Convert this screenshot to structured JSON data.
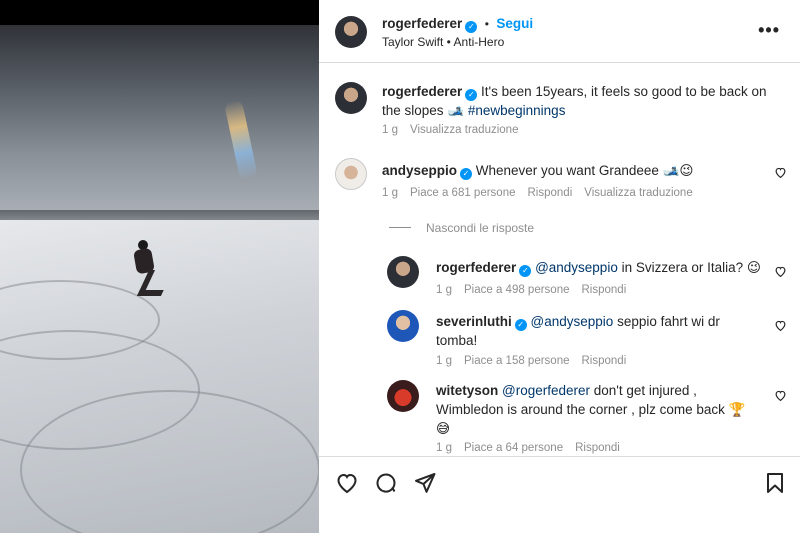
{
  "post_header": {
    "username": "rogerfederer",
    "verified_mark": "✓",
    "separator": "•",
    "follow_label": "Segui",
    "audio": "Taylor Swift • Anti-Hero",
    "more_label": "•••"
  },
  "caption": {
    "username": "rogerfederer",
    "text": " It's been 15years, it feels so good to be back on the slopes 🎿 ",
    "hashtag": "#newbeginnings",
    "time": "1 g",
    "translate": "Visualizza traduzione"
  },
  "comments": [
    {
      "username": "andyseppio",
      "text": " Whenever you want Grandeee 🎿😉",
      "time": "1 g",
      "likes": "Piace a 681 persone",
      "reply": "Rispondi",
      "translate": "Visualizza traduzione"
    }
  ],
  "hide_replies": "Nascondi le risposte",
  "replies": [
    {
      "username": "rogerfederer",
      "mention": "@andyseppio",
      "text": " in Svizzera or Italia? 😉",
      "time": "1 g",
      "likes": "Piace a 498 persone",
      "reply": "Rispondi"
    },
    {
      "username": "severinluthi",
      "mention": "@andyseppio",
      "text": " seppio fahrt wi dr tomba!",
      "time": "1 g",
      "likes": "Piace a 158 persone",
      "reply": "Rispondi"
    },
    {
      "username": "witetyson",
      "mention": "@rogerfederer",
      "text": " don't get injured , Wimbledon is around the corner , plz come back 🏆 😅",
      "time": "1 g",
      "likes": "Piace a 64 persone",
      "reply": "Rispondi"
    }
  ],
  "icons": {
    "like": "heart-icon",
    "comment": "comment-icon",
    "share": "send-icon",
    "save": "bookmark-icon"
  },
  "colors": {
    "accent": "#0095f6",
    "muted": "#8e8e8e",
    "link": "#00376b"
  }
}
